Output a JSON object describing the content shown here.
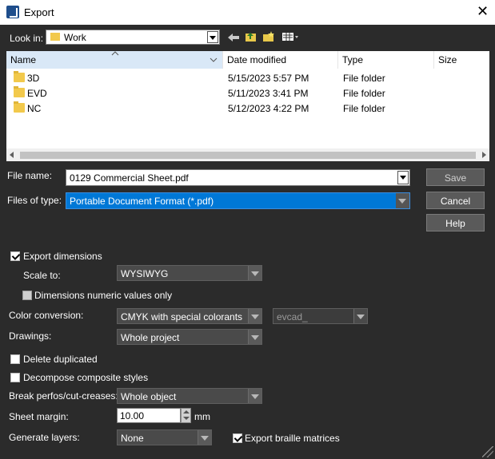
{
  "window": {
    "title": "Export",
    "close_glyph": "✕"
  },
  "look_in": {
    "label": "Look in:",
    "value": "Work"
  },
  "file_list": {
    "columns": [
      "Name",
      "Date modified",
      "Type",
      "Size"
    ],
    "rows": [
      {
        "name": "3D",
        "date": "5/15/2023 5:57 PM",
        "type": "File folder",
        "size": ""
      },
      {
        "name": "EVD",
        "date": "5/11/2023 3:41 PM",
        "type": "File folder",
        "size": ""
      },
      {
        "name": "NC",
        "date": "5/12/2023 4:22 PM",
        "type": "File folder",
        "size": ""
      }
    ]
  },
  "file_name": {
    "label": "File name:",
    "value": "0129 Commercial Sheet.pdf"
  },
  "files_of_type": {
    "label": "Files of type:",
    "value": "Portable Document Format (*.pdf)"
  },
  "buttons": {
    "save": "Save",
    "cancel": "Cancel",
    "help": "Help"
  },
  "options": {
    "export_dimensions": {
      "label": "Export dimensions",
      "checked": true
    },
    "scale_to": {
      "label": "Scale to:",
      "value": "WYSIWYG"
    },
    "dimensions_numeric": {
      "label": "Dimensions numeric values only",
      "checked": false
    },
    "color_conversion": {
      "label": "Color conversion:",
      "value": "CMYK with special colorants",
      "secondary": "evcad_"
    },
    "drawings": {
      "label": "Drawings:",
      "value": "Whole project"
    },
    "delete_duplicated": {
      "label": "Delete duplicated",
      "checked": false
    },
    "decompose": {
      "label": "Decompose composite styles",
      "checked": false
    },
    "break_perfos": {
      "label": "Break perfos/cut-creases:",
      "value": "Whole object"
    },
    "sheet_margin": {
      "label": "Sheet margin:",
      "value": "10.00",
      "unit": "mm"
    },
    "generate_layers": {
      "label": "Generate layers:",
      "value": "None"
    },
    "export_braille": {
      "label": "Export braille matrices",
      "checked": true
    }
  },
  "colors": {
    "dialog_bg": "#2b2b2b",
    "selection": "#0078d7",
    "header_highlight": "#d9e8f7"
  },
  "icons": [
    "app-icon",
    "folder-icon",
    "back-icon",
    "up-folder-icon",
    "new-folder-icon",
    "view-menu-icon"
  ]
}
